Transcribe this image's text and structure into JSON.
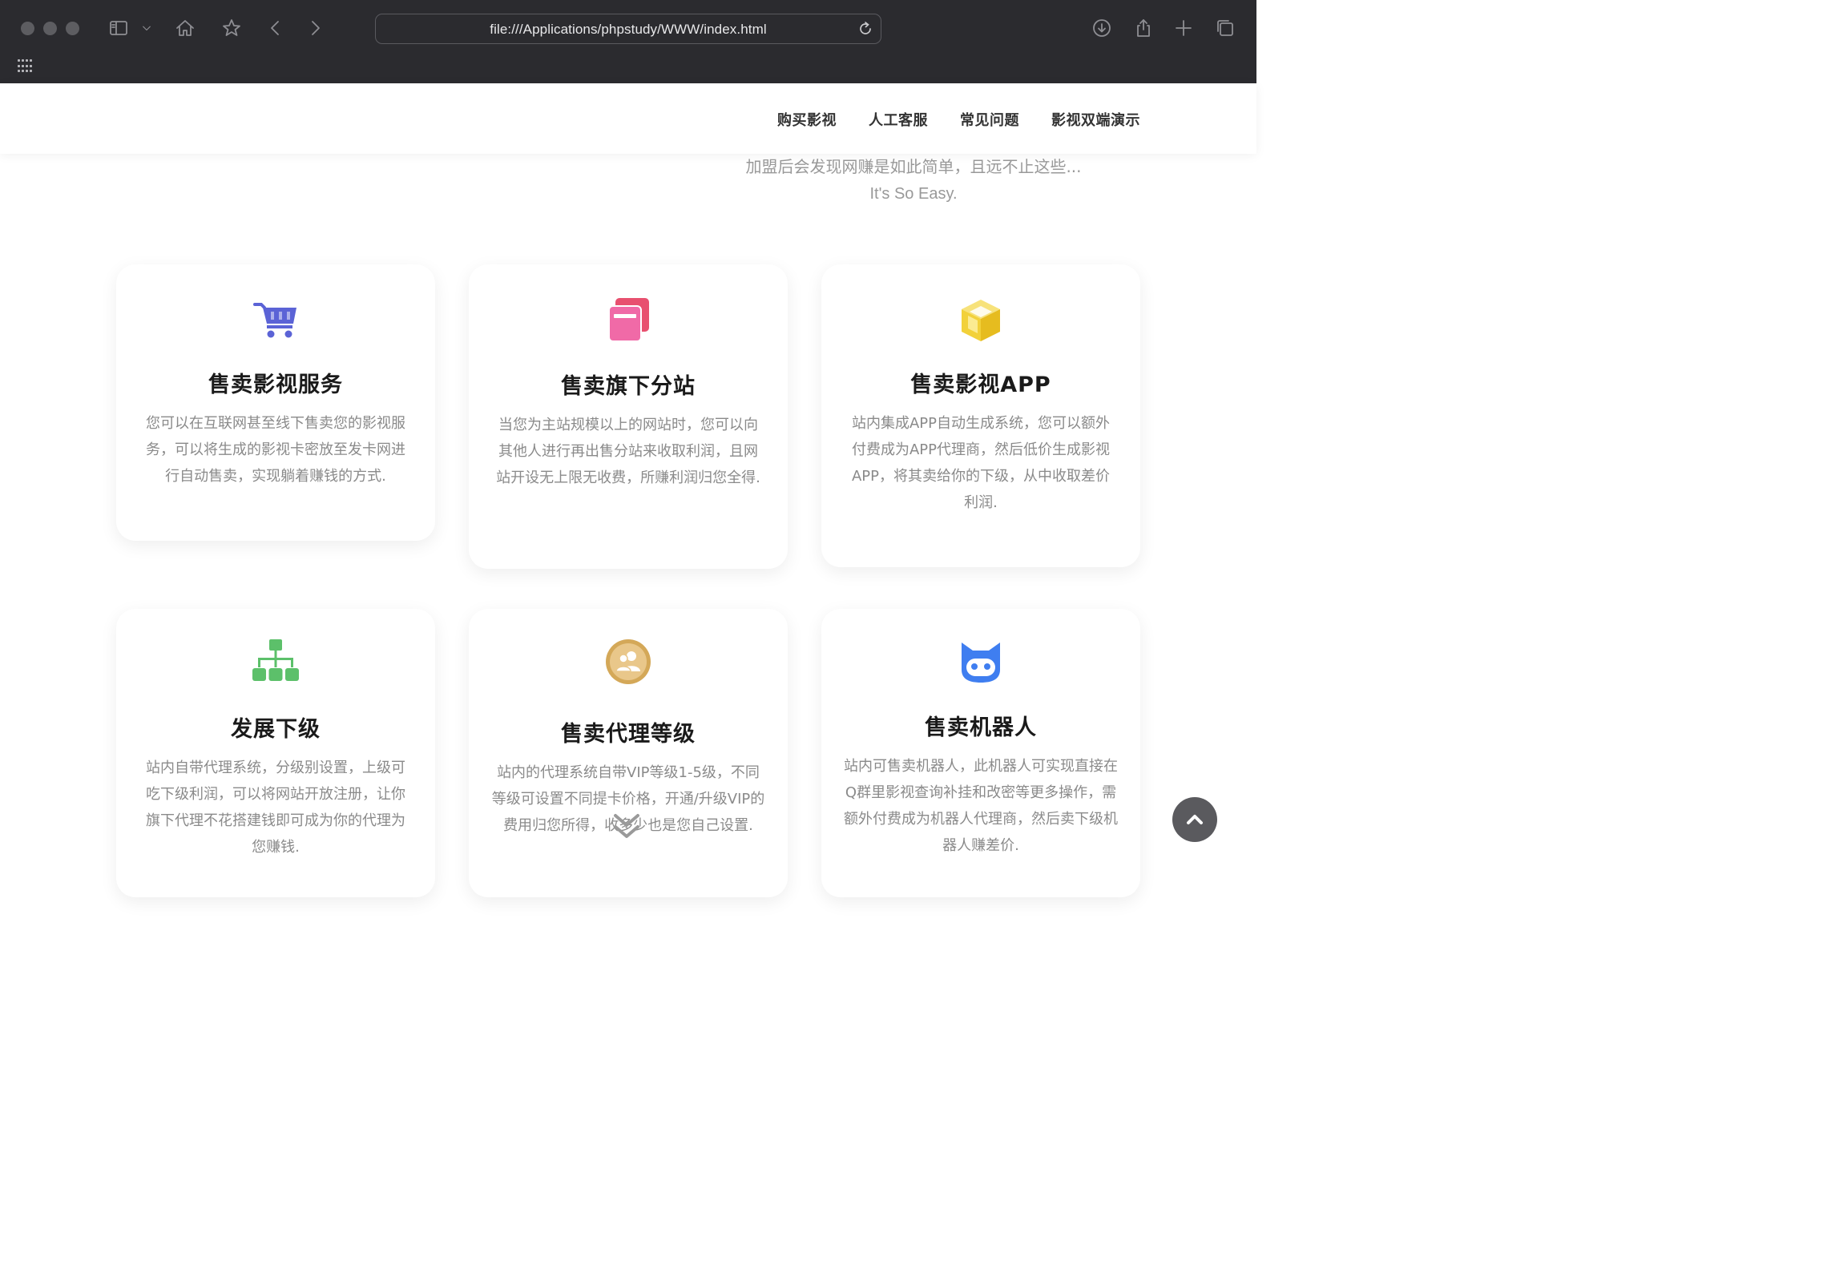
{
  "browser": {
    "url": "file:///Applications/phpstudy/WWW/index.html"
  },
  "nav": {
    "items": [
      "购买影视",
      "人工客服",
      "常见问题",
      "影视双端演示"
    ]
  },
  "intro": {
    "line1": "加盟后会发现网赚是如此简单，且远不止这些...",
    "line2": "It's So Easy."
  },
  "cards": [
    {
      "title": "售卖影视服务",
      "desc": "您可以在互联网甚至线下售卖您的影视服务，可以将生成的影视卡密放至发卡网进行自动售卖，实现躺着赚钱的方式.",
      "icon": "shopping-cart-icon"
    },
    {
      "title": "售卖旗下分站",
      "desc": "当您为主站规模以上的网站时，您可以向其他人进行再出售分站来收取利润，且网站开设无上限无收费，所赚利润归您全得.",
      "icon": "stacked-cards-icon"
    },
    {
      "title": "售卖影视APP",
      "desc": "站内集成APP自动生成系统，您可以额外付费成为APP代理商，然后低价生成影视APP，将其卖给你的下级，从中收取差价利润.",
      "icon": "cube-icon"
    },
    {
      "title": "发展下级",
      "desc": "站内自带代理系统，分级别设置，上级可吃下级利润，可以将网站开放注册，让你旗下代理不花搭建钱即可成为你的代理为您赚钱.",
      "icon": "org-chart-icon"
    },
    {
      "title": "售卖代理等级",
      "desc": "站内的代理系统自带VIP等级1-5级，不同等级可设置不同提卡价格，开通/升级VIP的费用归您所得，收多少也是您自己设置.",
      "icon": "user-group-icon"
    },
    {
      "title": "售卖机器人",
      "desc": "站内可售卖机器人，此机器人可实现直接在Q群里影视查询补挂和改密等更多操作，需额外付费成为机器人代理商，然后卖下级机器人赚差价.",
      "icon": "robot-icon"
    }
  ],
  "colors": {
    "chrome_bg": "#2b2b2f",
    "cart_blue": "#5b63d6",
    "cards_pink": "#e8506f",
    "cube_yellow": "#f2d13a",
    "org_green": "#5cc06a",
    "user_gold": "#d4a858",
    "robot_blue": "#3f7ef0"
  }
}
